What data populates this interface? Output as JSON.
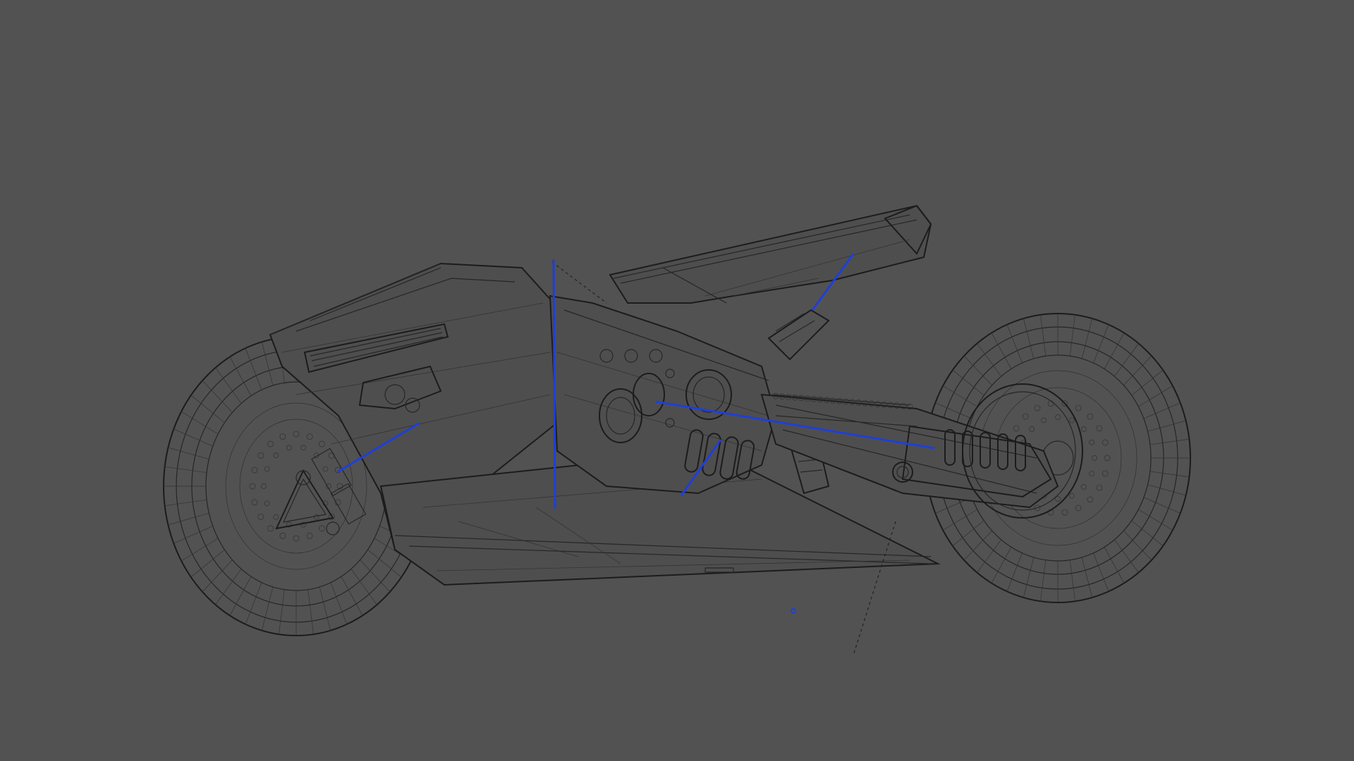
{
  "viewport": {
    "background_color": "#525252",
    "wire_color": "#262626",
    "bone_color": "#1f3fd8",
    "display_mode": "wireframe",
    "subject": "motorcycle-model"
  },
  "armature": {
    "bones": [
      {
        "name": "front-fork-bone"
      },
      {
        "name": "vertical-bone"
      },
      {
        "name": "swingarm-bone"
      },
      {
        "name": "seat-bone"
      },
      {
        "name": "engine-bone"
      }
    ],
    "pivot_point": {
      "name": "pivot-point-marker"
    }
  }
}
